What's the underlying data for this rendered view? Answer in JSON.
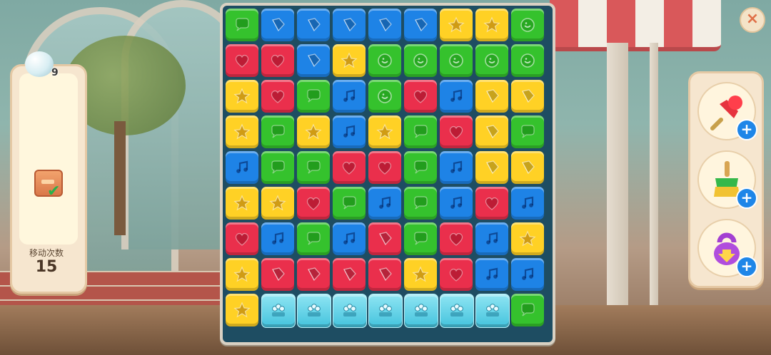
{
  "game": {
    "goals": [
      {
        "icon": "bubble-ball-icon",
        "count": "9"
      },
      {
        "icon": "wooden-box-icon",
        "status": "completed"
      }
    ],
    "moves_label": "移动次数",
    "moves_value": "15"
  },
  "board": {
    "rows": 9,
    "cols": 9,
    "tiles": [
      [
        "green-speech",
        "blue-kite",
        "blue-kite",
        "blue-kite",
        "blue-kite",
        "blue-kite",
        "yellow-star",
        "yellow-star",
        "green-smile"
      ],
      [
        "red-heart",
        "red-heart",
        "blue-kite",
        "yellow-star",
        "green-smile",
        "green-smile",
        "green-smile",
        "green-smile",
        "green-smile"
      ],
      [
        "yellow-star",
        "red-heart",
        "green-speech",
        "blue-note",
        "green-smile",
        "red-heart",
        "blue-note",
        "yellow-kite",
        "yellow-kite"
      ],
      [
        "yellow-star",
        "green-speech",
        "yellow-star",
        "blue-note",
        "yellow-star",
        "green-speech",
        "red-heart",
        "yellow-kite",
        "green-speech"
      ],
      [
        "blue-note",
        "green-speech",
        "green-speech",
        "red-heart",
        "red-heart",
        "green-speech",
        "blue-note",
        "yellow-kite",
        "yellow-kite"
      ],
      [
        "yellow-star",
        "yellow-star",
        "red-heart",
        "green-speech",
        "blue-note",
        "green-speech",
        "blue-note",
        "red-heart",
        "blue-note"
      ],
      [
        "red-heart",
        "blue-note",
        "green-speech",
        "blue-note",
        "red-kite",
        "green-speech",
        "red-heart",
        "blue-note",
        "yellow-star"
      ],
      [
        "yellow-star",
        "red-kite",
        "red-kite",
        "red-kite",
        "red-kite",
        "yellow-star",
        "red-heart",
        "blue-note",
        "blue-note"
      ],
      [
        "yellow-star",
        "ice-crate",
        "ice-crate",
        "ice-crate",
        "ice-crate",
        "ice-crate",
        "ice-crate",
        "ice-crate",
        "green-speech"
      ]
    ]
  },
  "boosters": [
    {
      "icon": "pushpin-hammer-icon",
      "add": "+"
    },
    {
      "icon": "broom-icon",
      "add": "+"
    },
    {
      "icon": "kettlebell-icon",
      "add": "+"
    }
  ],
  "close": "×",
  "colors": {
    "green": "#35c22d",
    "blue": "#1e83e6",
    "yellow": "#ffd125",
    "red": "#ea2f4c",
    "ice": "#5ccde3"
  }
}
